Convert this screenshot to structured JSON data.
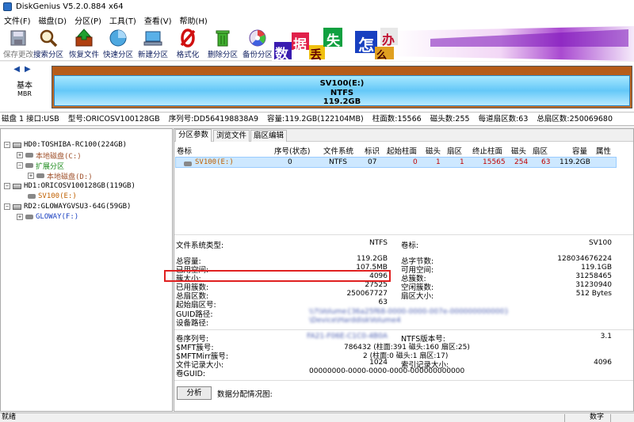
{
  "window": {
    "title": "DiskGenius V5.2.0.884 x64"
  },
  "menu": [
    "文件(F)",
    "磁盘(D)",
    "分区(P)",
    "工具(T)",
    "查看(V)",
    "帮助(H)"
  ],
  "toolbar": [
    {
      "label": "保存更改",
      "icon": "save-icon",
      "dim": true
    },
    {
      "label": "搜索分区",
      "icon": "search-partition-icon"
    },
    {
      "label": "恢复文件",
      "icon": "recover-file-icon"
    },
    {
      "label": "快速分区",
      "icon": "quick-partition-icon"
    },
    {
      "label": "新建分区",
      "icon": "new-partition-icon"
    },
    {
      "label": "格式化",
      "icon": "format-icon"
    },
    {
      "label": "删除分区",
      "icon": "delete-partition-icon"
    },
    {
      "label": "备份分区",
      "icon": "backup-partition-icon"
    }
  ],
  "banner": {
    "chars": [
      "数",
      "据",
      "丢",
      "失",
      "怎",
      "么",
      "办"
    ]
  },
  "disk_map": {
    "nav_label": "基本",
    "nav_sub": "MBR",
    "partition": {
      "name": "SV100(E:)",
      "fs": "NTFS",
      "size": "119.2GB"
    }
  },
  "disk_info": [
    "磁盘 1 接口:USB",
    "型号:ORICOSV100128GB",
    "序列号:DD564198838A9",
    "容量:119.2GB(122104MB)",
    "柱面数:15566",
    "磁头数:255",
    "每道扇区数:63",
    "总扇区数:250069680"
  ],
  "tree": [
    {
      "text": "HD0:TOSHIBA-RC100(224GB)",
      "color": "#000000"
    },
    {
      "text": "本地磁盘(C:)",
      "color": "#a0522d"
    },
    {
      "text": "扩展分区",
      "color": "#1a8a1a"
    },
    {
      "text": "本地磁盘(D:)",
      "color": "#a0522d"
    },
    {
      "text": "HD1:ORICOSV100128GB(119GB)",
      "color": "#000000"
    },
    {
      "text": "SV100(E:)",
      "color": "#c06000"
    },
    {
      "text": "RD2:GLOWAYGVSU3-64G(59GB)",
      "color": "#000000"
    },
    {
      "text": "GLOWAY(F:)",
      "color": "#1a40c0"
    }
  ],
  "tabs": [
    "分区参数",
    "浏览文件",
    "扇区编辑"
  ],
  "table": {
    "headers": [
      "卷标",
      "序号(状态)",
      "文件系统",
      "标识",
      "起始柱面",
      "磁头",
      "扇区",
      "终止柱面",
      "磁头",
      "扇区",
      "容量",
      "属性"
    ],
    "row": {
      "label": "SV100(E:)",
      "index": "0",
      "fs": "NTFS",
      "id": "07",
      "start_cyl": "0",
      "start_head": "1",
      "start_sec": "1",
      "end_cyl": "15565",
      "end_head": "254",
      "end_sec": "63",
      "size": "119.2GB",
      "attr": ""
    }
  },
  "details": {
    "fs_type_label": "文件系统类型:",
    "fs_type": "NTFS",
    "vol_label_label": "卷标:",
    "vol_label": "SV100",
    "total_label": "总容量:",
    "total": "119.2GB",
    "total_bytes_label": "总字节数:",
    "total_bytes": "128034676224",
    "used_label": "已用空间:",
    "used": "107.5MB",
    "free_label": "可用空间:",
    "free": "119.1GB",
    "cluster_size_label": "簇大小:",
    "cluster_size": "4096",
    "total_clusters_label": "总簇数:",
    "total_clusters": "31258465",
    "used_clusters_label": "已用簇数:",
    "used_clusters": "27525",
    "free_clusters_label": "空闲簇数:",
    "free_clusters": "31230940",
    "total_sectors_label": "总扇区数:",
    "total_sectors": "250067727",
    "sector_size_label": "扇区大小:",
    "sector_size": "512 Bytes",
    "start_sector_label": "起始扇区号:",
    "start_sector": "63",
    "guid_path_label": "GUID路径:",
    "guid_path": "\\\\?\\Volume{36a25f68-0000-0000-007e-000000000000}",
    "device_path_label": "设备路径:",
    "device_path": "\\Device\\HarddiskVolume4",
    "serial_label": "卷序列号:",
    "serial": "FA21-F06E-C1C0-4B0A",
    "ntfs_ver_label": "NTFS版本号:",
    "ntfs_ver": "3.1",
    "mft_label": "$MFT簇号:",
    "mft": "786432 (柱面:391 磁头:160 扇区:25)",
    "mftmirr_label": "$MFTMirr簇号:",
    "mftmirr": "2 (柱面:0 磁头:1 扇区:17)",
    "record_size_label": "文件记录大小:",
    "record_size": "1024",
    "index_size_label": "索引记录大小:",
    "index_size": "4096",
    "vol_guid_label": "卷GUID:",
    "vol_guid": "00000000-0000-0000-0000-000000000000"
  },
  "analyze": {
    "button": "分析",
    "label": "数据分配情况图:"
  },
  "status": {
    "left": "就绪",
    "right": "数字"
  }
}
